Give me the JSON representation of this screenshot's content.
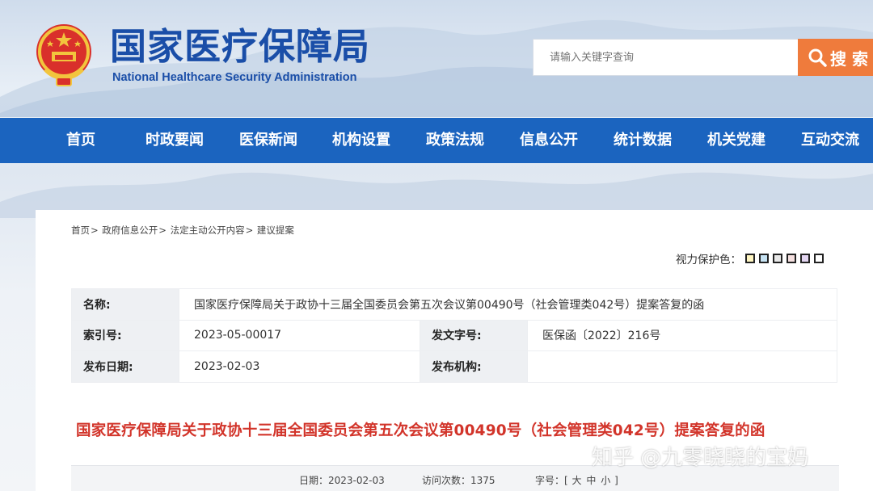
{
  "header": {
    "logo_cn": "国家医疗保障局",
    "logo_en": "National Healthcare Security Administration",
    "search_placeholder": "请输入关键字查询",
    "search_button": "搜 索"
  },
  "nav": {
    "items": [
      "首页",
      "时政要闻",
      "医保新闻",
      "机构设置",
      "政策法规",
      "信息公开",
      "统计数据",
      "机关党建",
      "互动交流"
    ]
  },
  "breadcrumb": {
    "items": [
      "首页",
      "政府信息公开",
      "法定主动公开内容",
      "建议提案"
    ],
    "separator": ">"
  },
  "vision_protect": {
    "label": "视力保护色：",
    "colors": [
      "#fff6c2",
      "#c7e3f3",
      "#e8e8e8",
      "#f5e0e0",
      "#e4d6f2",
      "#ffffff"
    ]
  },
  "meta": {
    "name_label": "名称:",
    "name_value": "国家医疗保障局关于政协十三届全国委员会第五次会议第00490号（社会管理类042号）提案答复的函",
    "index_label": "索引号:",
    "index_value": "2023-05-00017",
    "docno_label": "发文字号:",
    "docno_value": "医保函〔2022〕216号",
    "date_label": "发布日期:",
    "date_value": "2023-02-03",
    "org_label": "发布机构:",
    "org_value": ""
  },
  "doc_title": "国家医疗保障局关于政协十三届全国委员会第五次会议第00490号（社会管理类042号）提案答复的函",
  "info": {
    "date_label": "日期：",
    "date_value": "2023-02-03",
    "visits_label": "访问次数：",
    "visits_value": "1375",
    "font_label": "字号：",
    "bracket_open": "[",
    "size_large": "大",
    "size_medium": "中",
    "size_small": "小",
    "bracket_close": "]"
  },
  "watermark": "知乎 @九零晓晓的宝妈",
  "colors": {
    "brand_blue": "#1b64bf",
    "title_red": "#d2342a",
    "search_orange": "#ef7b3c"
  }
}
